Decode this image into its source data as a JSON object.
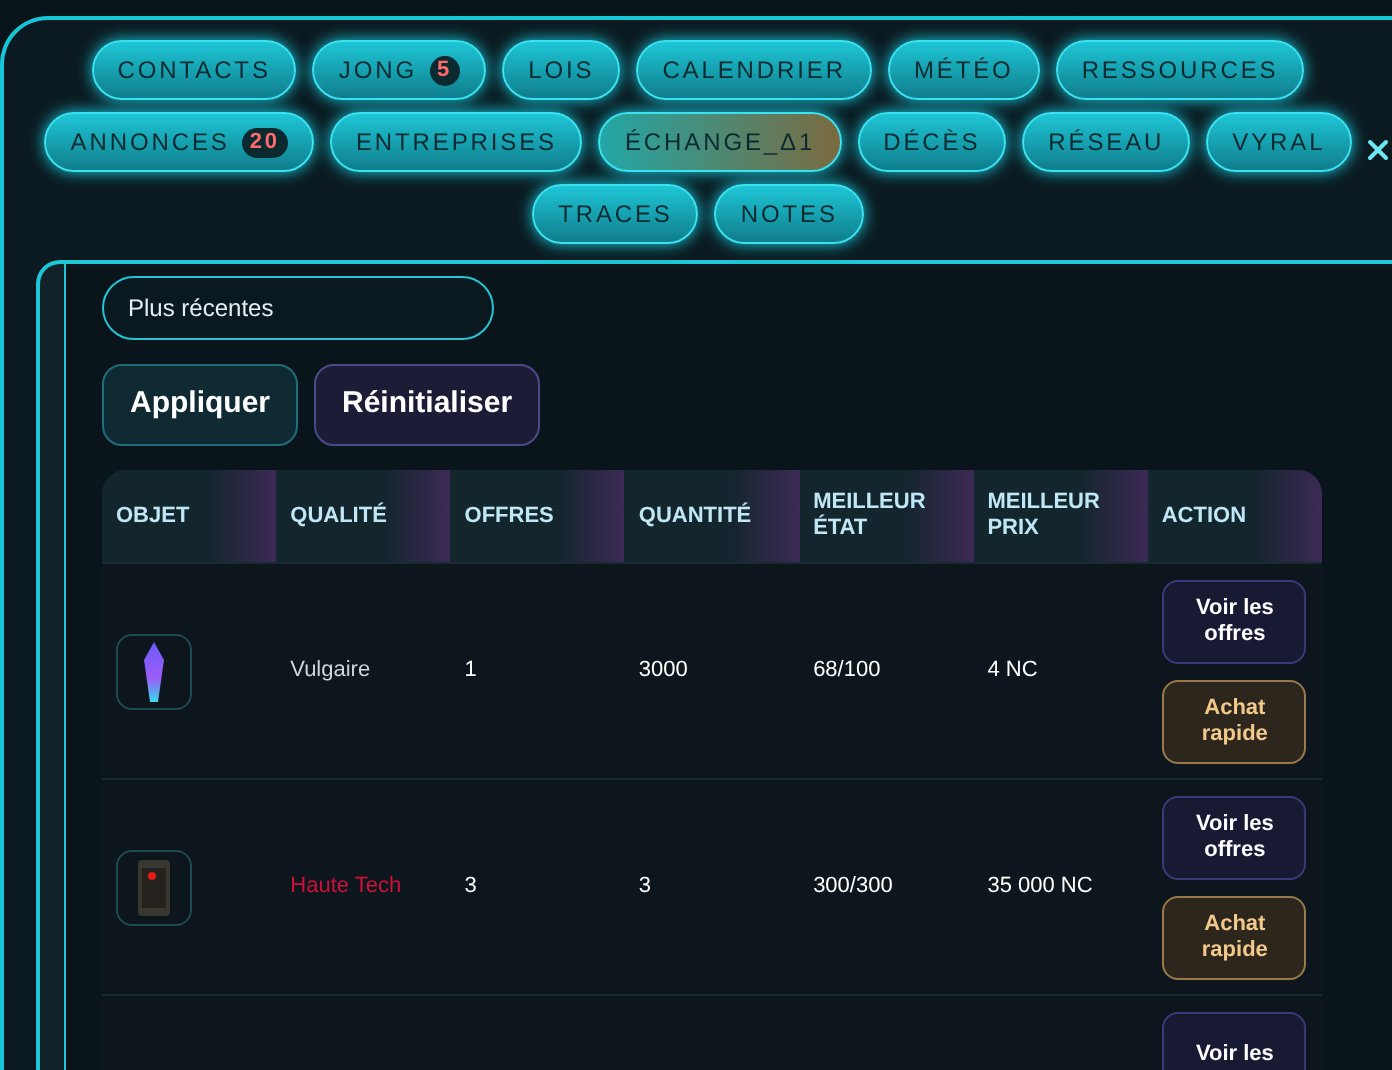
{
  "nav_tabs": [
    [
      {
        "label": "CONTACTS",
        "selected": false
      },
      {
        "label": "JONG",
        "badge": "5",
        "selected": false
      },
      {
        "label": "LOIS",
        "selected": false
      },
      {
        "label": "CALENDRIER",
        "selected": false
      },
      {
        "label": "MÉTÉO",
        "selected": false
      },
      {
        "label": "RESSOURCES",
        "selected": false
      }
    ],
    [
      {
        "label": "ANNONCES",
        "badge": "20",
        "selected": false
      },
      {
        "label": "ENTREPRISES",
        "selected": false
      },
      {
        "label": "ÉCHANGE_Δ1",
        "selected": true
      },
      {
        "label": "DÉCÈS",
        "selected": false
      },
      {
        "label": "RÉSEAU",
        "selected": false
      },
      {
        "label": "VYRAL",
        "selected": false
      }
    ],
    [
      {
        "label": "TRACES",
        "selected": false
      },
      {
        "label": "NOTES",
        "selected": false
      }
    ]
  ],
  "sort_field": {
    "value": "Plus récentes"
  },
  "buttons": [
    "Appliquer",
    "Réinitialiser"
  ],
  "table": {
    "columns": [
      "OBJET",
      "QUALITÉ",
      "OFFRES",
      "QUANTITÉ",
      "MEILLEUR ÉTAT",
      "MEILLEUR PRIX",
      "ACTION"
    ],
    "rows": [
      {
        "kind": "crystal",
        "quality": "Vulgaire",
        "color": "#d1d5db",
        "offers": "1",
        "quantity": "3000",
        "best_state": "68/100",
        "best_price": "4 NC",
        "actions": [
          "Voir les offres",
          "Achat rapide"
        ]
      },
      {
        "kind": "armor",
        "quality": "Haute Tech",
        "color": "#d0103a",
        "offers": "3",
        "quantity": "3",
        "best_state": "300/300",
        "best_price": "35 000 NC",
        "actions": [
          "Voir les offres",
          "Achat rapide"
        ]
      },
      {
        "kind": "empty",
        "actions": [
          "Voir les"
        ]
      }
    ]
  }
}
